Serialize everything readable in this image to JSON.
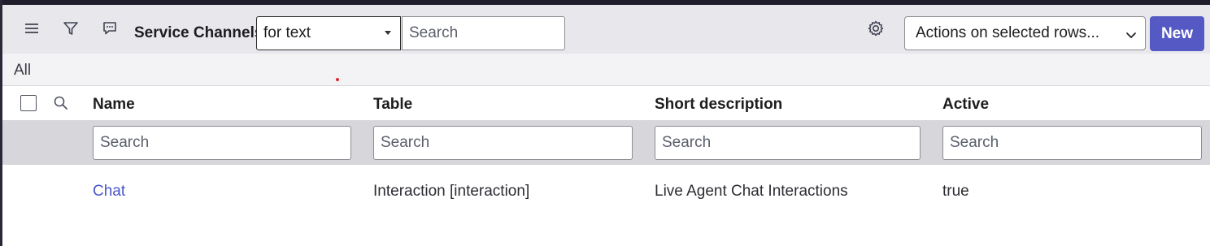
{
  "header": {
    "title": "Service Channels",
    "search_field_select": "for text",
    "search_placeholder": "Search",
    "actions_select": "Actions on selected rows...",
    "new_label": "New"
  },
  "breadcrumb": "All",
  "columns": [
    "Name",
    "Table",
    "Short description",
    "Active"
  ],
  "column_search_placeholder": "Search",
  "rows": [
    {
      "name": "Chat",
      "table": "Interaction [interaction]",
      "short_description": "Live Agent Chat Interactions",
      "active": "true"
    }
  ],
  "icons": {
    "menu": "hamburger-icon",
    "filter": "funnel-icon",
    "chat": "chat-bubble-icon",
    "settings": "gear-icon",
    "column_search": "magnifier-icon"
  },
  "colors": {
    "primary_button": "#5559c3",
    "link": "#4a55c8",
    "header_bg": "#e8e8ec",
    "filter_row_bg": "#d6d6db"
  }
}
